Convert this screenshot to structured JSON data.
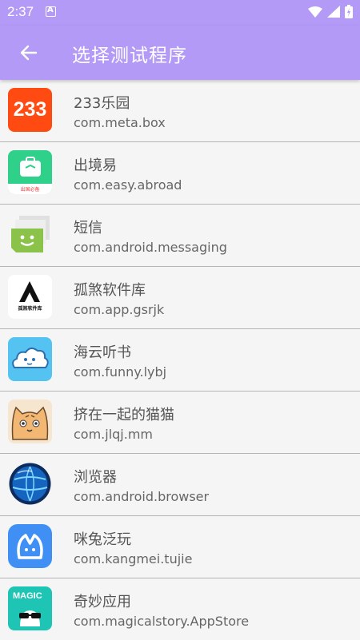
{
  "status": {
    "time": "2:37"
  },
  "header": {
    "title": "选择测试程序"
  },
  "apps": [
    {
      "name": "233乐园",
      "package": "com.meta.box",
      "icon": "233-logo-icon",
      "icon_text": "233"
    },
    {
      "name": "出境易",
      "package": "com.easy.abroad",
      "icon": "suitcase-icon",
      "icon_text": "出国必备"
    },
    {
      "name": "短信",
      "package": "com.android.messaging",
      "icon": "messaging-icon"
    },
    {
      "name": "孤煞软件库",
      "package": "com.app.gsrjk",
      "icon": "gusha-logo-icon",
      "icon_text": "孤煞软件库"
    },
    {
      "name": "海云听书",
      "package": "com.funny.lybj",
      "icon": "cloud-icon"
    },
    {
      "name": "挤在一起的猫猫",
      "package": "com.jlqj.mm",
      "icon": "cat-icon"
    },
    {
      "name": "浏览器",
      "package": "com.android.browser",
      "icon": "globe-icon"
    },
    {
      "name": "咪兔泛玩",
      "package": "com.kangmei.tujie",
      "icon": "rabbit-icon"
    },
    {
      "name": "奇妙应用",
      "package": "com.magicalstory.AppStore",
      "icon": "magic-glasses-icon",
      "icon_text": "MAGIC"
    }
  ]
}
